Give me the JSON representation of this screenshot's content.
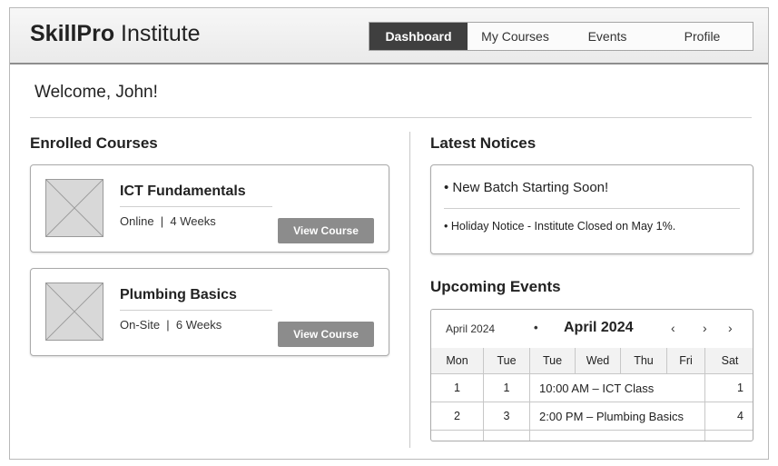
{
  "brand": {
    "bold": "SkillPro",
    "rest": " Institute"
  },
  "nav": {
    "items": [
      "Dashboard",
      "My Courses",
      "Events",
      "Profile"
    ],
    "active": "Dashboard"
  },
  "welcome": "Welcome, John!",
  "enrolled": {
    "title": "Enrolled Courses",
    "courses": [
      {
        "title": "ICT Fundamentals",
        "meta": "Online  |  4 Weeks",
        "button": "View Course"
      },
      {
        "title": "Plumbing Basics",
        "meta": "On-Site  |  6 Weeks",
        "button": "View Course"
      }
    ]
  },
  "notices": {
    "title": "Latest Notices",
    "items": [
      "• New Batch Starting Soon!",
      "• Holiday Notice - Institute Closed on May 1%."
    ]
  },
  "events": {
    "title": "Upcoming Events",
    "month_small": "April 2024",
    "dot": "•",
    "month": "April 2024",
    "prev": "‹",
    "next": "›",
    "next2": "›",
    "days": [
      "Mon",
      "Tue",
      "Tue",
      "Wed",
      "Thu",
      "Fri",
      "Sat"
    ],
    "rows": [
      {
        "a": "1",
        "b": "1",
        "event": "10:00 AM  –  ICT Class",
        "end": "1"
      },
      {
        "a": "2",
        "b": "3",
        "event": "2:00 PM – Plumbing Basics",
        "end": "4"
      }
    ]
  }
}
